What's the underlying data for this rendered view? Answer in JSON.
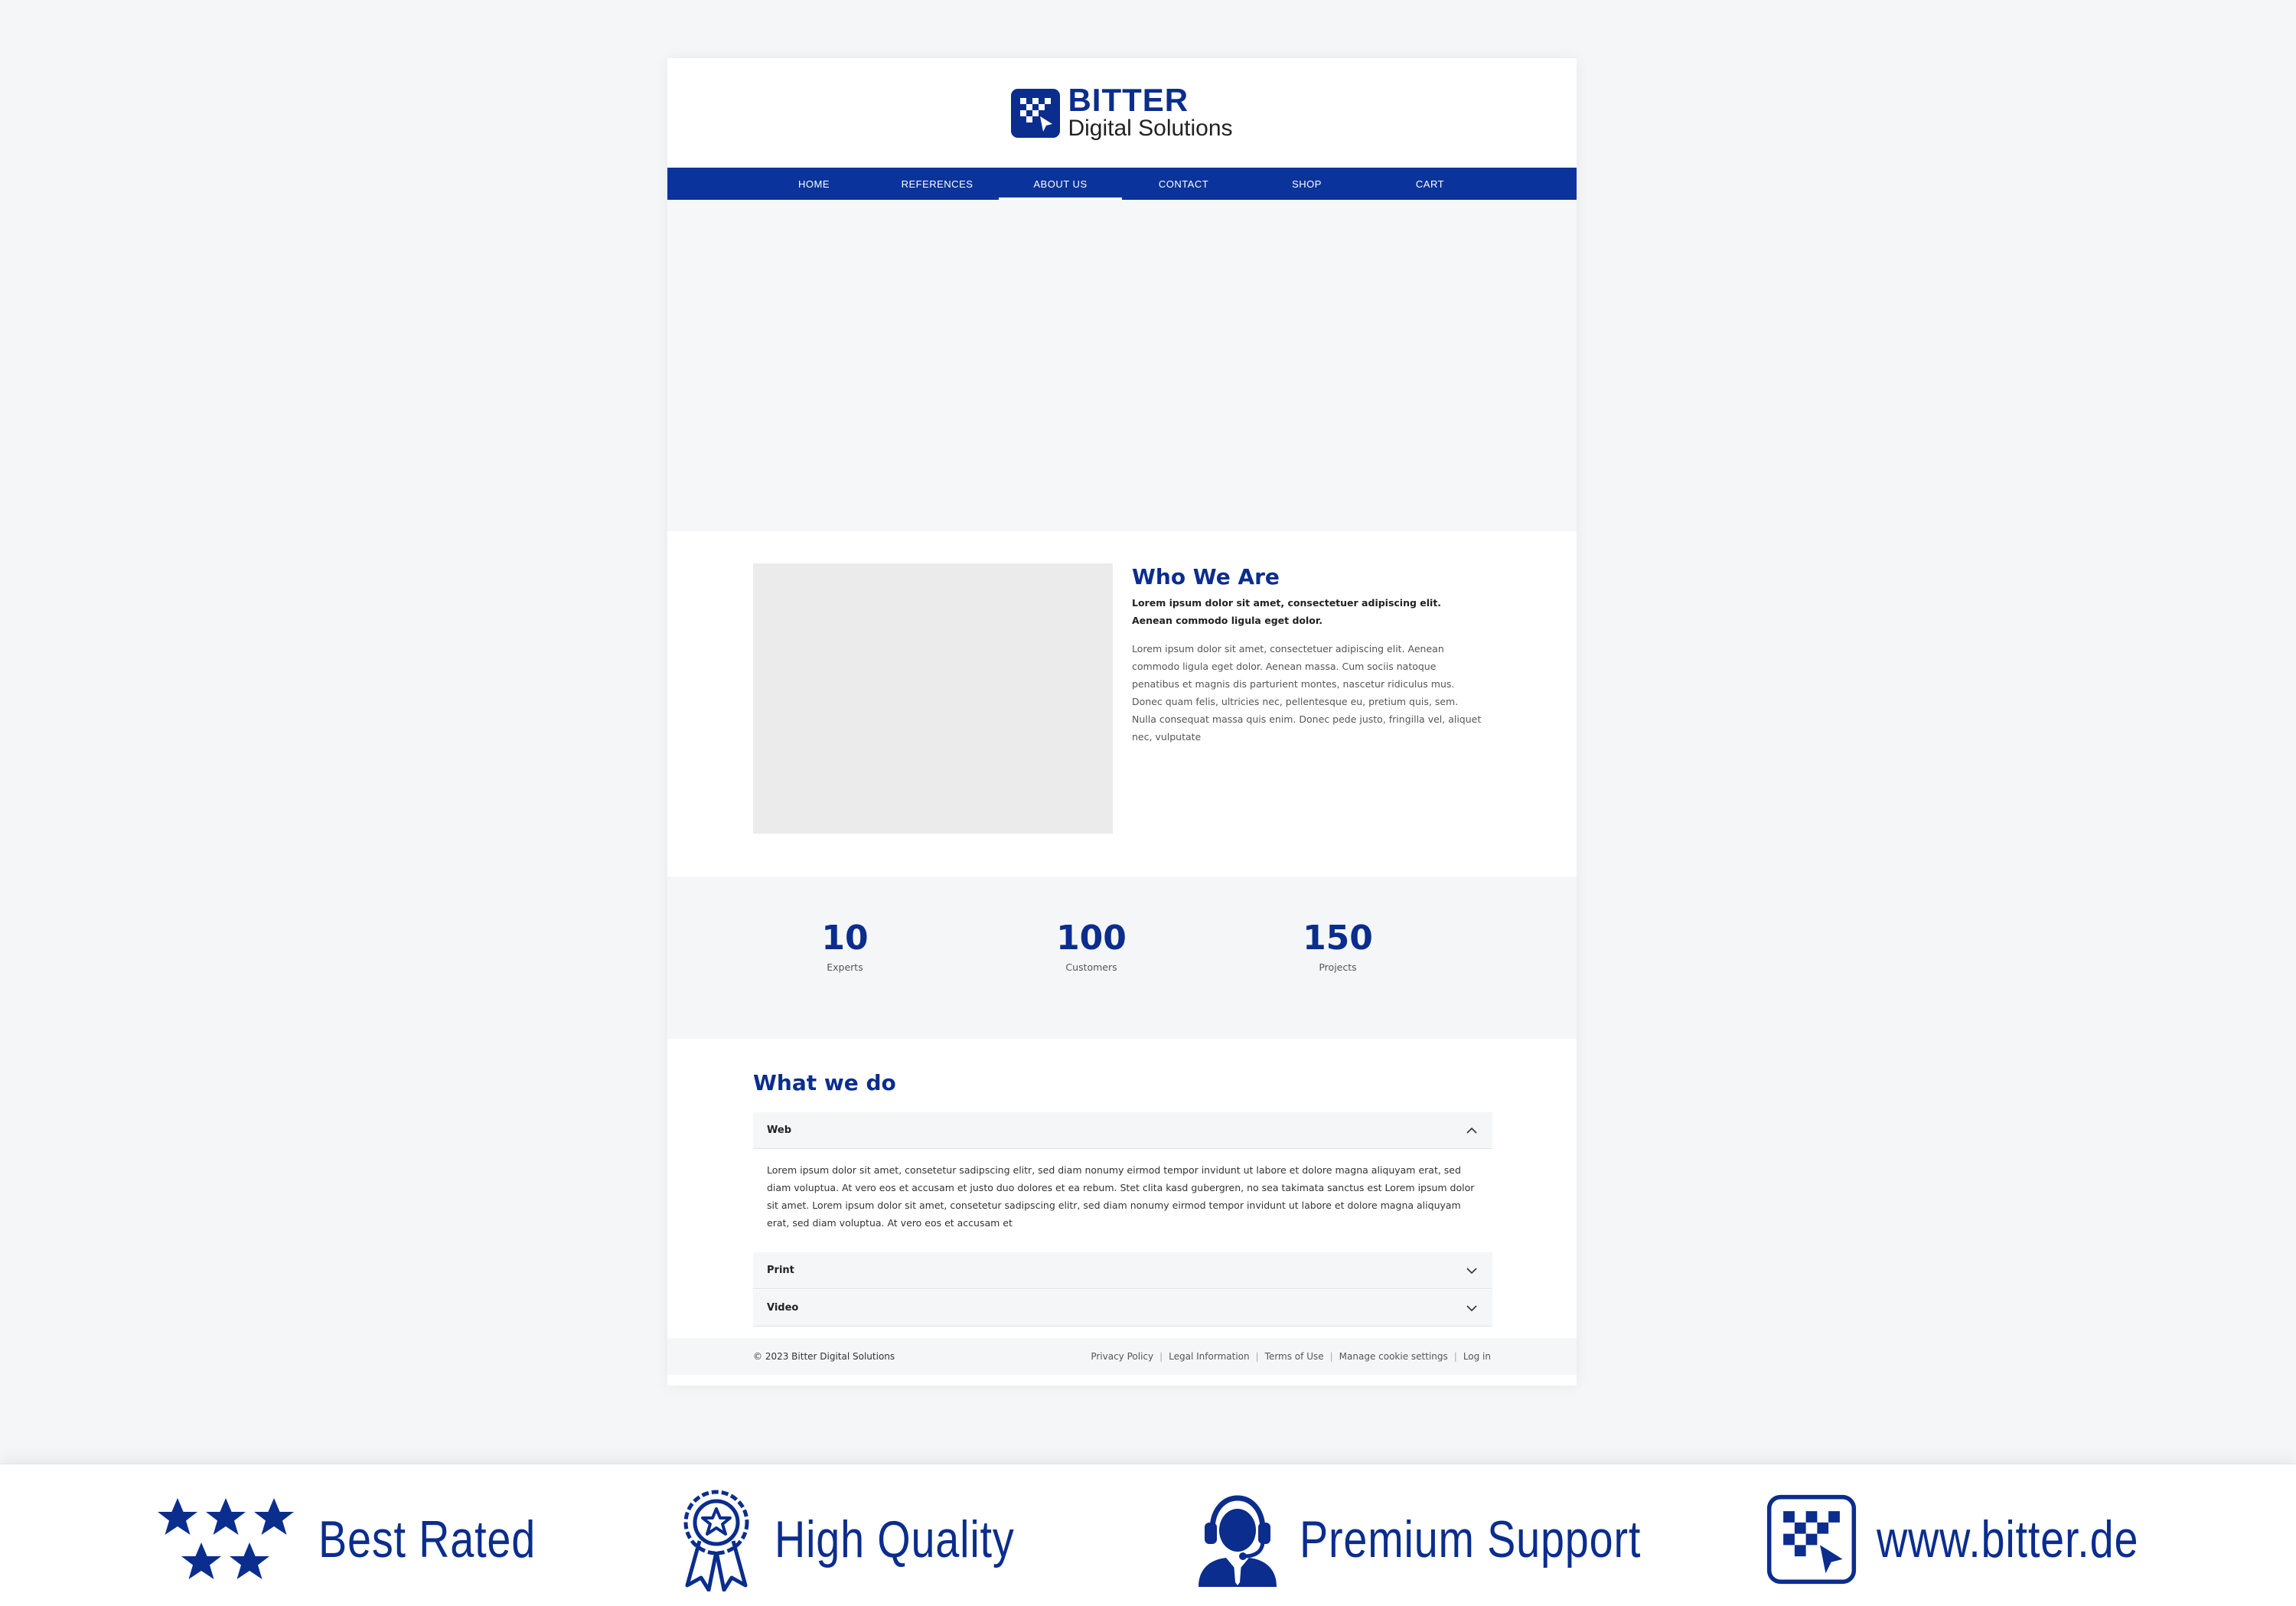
{
  "site": {
    "brand": "BITTER",
    "brand_sub": "Digital Solutions"
  },
  "nav": {
    "items": [
      {
        "label": "HOME"
      },
      {
        "label": "REFERENCES"
      },
      {
        "label": "ABOUT US",
        "active": true
      },
      {
        "label": "CONTACT"
      },
      {
        "label": "SHOP"
      },
      {
        "label": "CART"
      }
    ]
  },
  "who": {
    "title": "Who We Are",
    "lead": "Lorem ipsum dolor sit amet, consectetuer adipiscing elit. Aenean commodo ligula eget dolor.",
    "body": "Lorem ipsum dolor sit amet, consectetuer adipiscing elit. Aenean commodo ligula eget dolor. Aenean massa. Cum sociis natoque penatibus et magnis dis parturient montes, nascetur ridiculus mus. Donec quam felis, ultricies nec, pellentesque eu, pretium quis, sem. Nulla consequat massa quis enim. Donec pede justo, fringilla vel, aliquet nec, vulputate"
  },
  "stats": [
    {
      "value": "10",
      "label": "Experts"
    },
    {
      "value": "100",
      "label": "Customers"
    },
    {
      "value": "150",
      "label": "Projects"
    }
  ],
  "services": {
    "title": "What we do",
    "items": [
      {
        "label": "Web",
        "expanded": true,
        "body": "Lorem ipsum dolor sit amet, consetetur sadipscing elitr, sed diam nonumy eirmod tempor invidunt ut labore et dolore magna aliquyam erat, sed diam voluptua. At vero eos et accusam et justo duo dolores et ea rebum. Stet clita kasd gubergren, no sea takimata sanctus est Lorem ipsum dolor sit amet. Lorem ipsum dolor sit amet, consetetur sadipscing elitr, sed diam nonumy eirmod tempor invidunt ut labore et dolore magna aliquyam erat, sed diam voluptua. At vero eos et accusam et"
      },
      {
        "label": "Print",
        "expanded": false
      },
      {
        "label": "Video",
        "expanded": false
      }
    ]
  },
  "footer": {
    "copyright": "© 2023 Bitter Digital Solutions",
    "links": [
      {
        "label": "Privacy Policy"
      },
      {
        "label": "Legal Information"
      },
      {
        "label": "Terms of Use"
      },
      {
        "label": "Manage cookie settings"
      },
      {
        "label": "Log in"
      }
    ]
  },
  "banner": {
    "badges": [
      {
        "label": "Best Rated",
        "icon": "stars-icon"
      },
      {
        "label": "High Quality",
        "icon": "award-ribbon-icon"
      },
      {
        "label": "Premium Support",
        "icon": "support-agent-icon"
      },
      {
        "label": "www.bitter.de",
        "icon": "bitter-logo-icon"
      }
    ]
  },
  "colors": {
    "brand_blue": "#0a2d8e",
    "nav_blue": "#0a349b",
    "light_bg": "#f5f6f8"
  }
}
